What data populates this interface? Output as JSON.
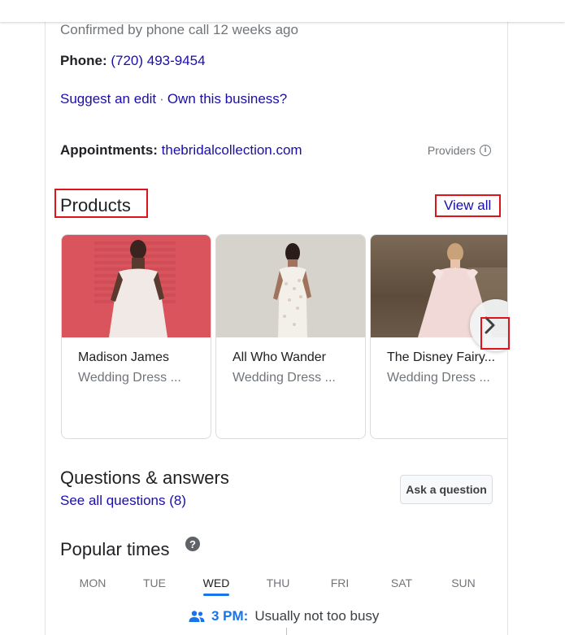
{
  "confirmation": "Confirmed by phone call 12 weeks ago",
  "phone": {
    "label": "Phone:",
    "value": "(720) 493-9454"
  },
  "links": {
    "suggest_edit": "Suggest an edit",
    "separator": "·",
    "own_business": "Own this business?"
  },
  "appointments": {
    "label": "Appointments:",
    "url": "thebridalcollection.com",
    "providers": "Providers"
  },
  "products": {
    "title": "Products",
    "view_all": "View all",
    "items": [
      {
        "name": "Madison James",
        "type": "Wedding Dress ..."
      },
      {
        "name": "All Who Wander",
        "type": "Wedding Dress ..."
      },
      {
        "name": "The Disney Fairy...",
        "type": "Wedding Dress ..."
      }
    ]
  },
  "qa": {
    "title": "Questions & answers",
    "see_all": "See all questions (8)",
    "ask_button": "Ask a question"
  },
  "popular_times": {
    "title": "Popular times",
    "help": "?",
    "days": [
      "MON",
      "TUE",
      "WED",
      "THU",
      "FRI",
      "SAT",
      "SUN"
    ],
    "selected_day": "WED",
    "current_time": "3 PM:",
    "status": "Usually not too busy"
  },
  "colors": {
    "link": "#1a0dab",
    "accent": "#1a73e8",
    "highlight": "#e0121a"
  }
}
